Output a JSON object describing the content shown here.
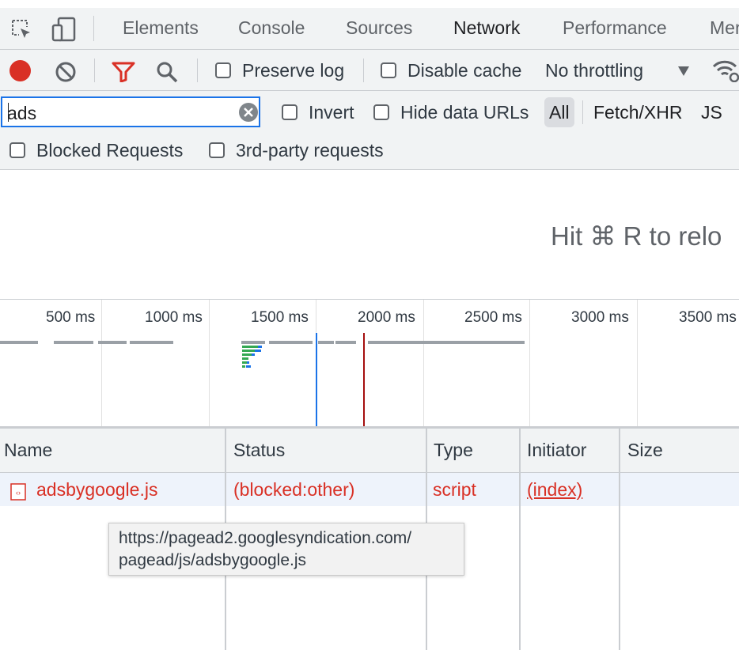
{
  "tabs": [
    "Elements",
    "Console",
    "Sources",
    "Network",
    "Performance",
    "Mer"
  ],
  "active_tab": "Network",
  "toolbar": {
    "preserve_log": "Preserve log",
    "disable_cache": "Disable cache",
    "throttling": "No throttling"
  },
  "filter": {
    "value": "ads",
    "invert": "Invert",
    "hide_data_urls": "Hide data URLs",
    "types": [
      "All",
      "Fetch/XHR",
      "JS"
    ],
    "blocked_requests": "Blocked Requests",
    "third_party": "3rd-party requests"
  },
  "reload_hint": "Hit ⌘ R to relo",
  "timeline": {
    "ticks": [
      "500 ms",
      "1000 ms",
      "1500 ms",
      "2000 ms",
      "2500 ms",
      "3000 ms",
      "3500 ms"
    ]
  },
  "table": {
    "headers": [
      "Name",
      "Status",
      "Type",
      "Initiator",
      "Size"
    ],
    "rows": [
      {
        "name": "adsbygoogle.js",
        "status": "(blocked:other)",
        "type": "script",
        "initiator": "(index)",
        "size": ""
      }
    ]
  },
  "tooltip": {
    "line1": "https://pagead2.googlesyndication.com/",
    "line2": "pagead/js/adsbygoogle.js"
  },
  "colors": {
    "record": "#d93025",
    "filter_active": "#d93025",
    "accent": "#1a73e8",
    "error_text": "#d93025"
  }
}
